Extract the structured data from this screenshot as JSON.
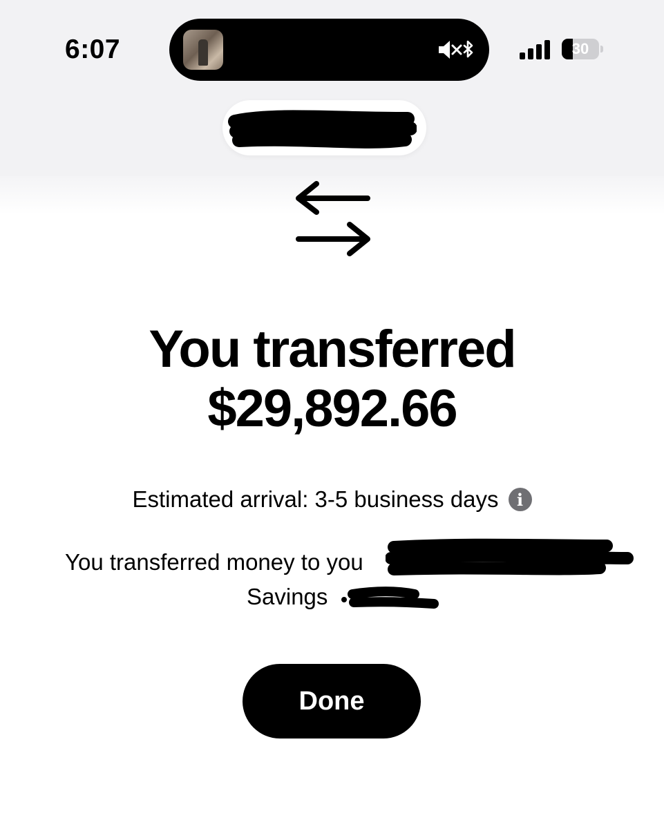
{
  "status_bar": {
    "time": "6:07",
    "battery": "30",
    "battery_level": 0.3,
    "live_activity_icon": "speaker-muted-bluetooth-icon",
    "signal_icon": "cellular-signal-icon"
  },
  "transfer_icon": "transfer-arrows-icon",
  "headline": {
    "line1": "You transferred",
    "line2": "$29,892.66"
  },
  "arrival": {
    "text": "Estimated arrival: 3-5 business days",
    "info_icon_glyph": "i"
  },
  "details": {
    "line1": "You transferred money to you",
    "line2": "Savings"
  },
  "done_button": {
    "label": "Done"
  },
  "colors": {
    "top_background": "#f2f2f4",
    "button_background": "#000000",
    "button_text": "#ffffff",
    "info_icon": "#6f6f73"
  }
}
